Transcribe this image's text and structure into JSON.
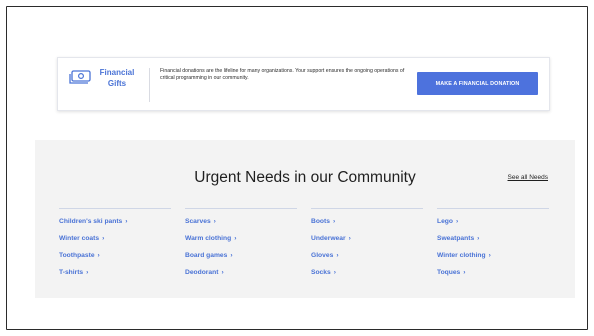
{
  "gifts": {
    "title": "Financial Gifts",
    "description": "Financial donations are the lifeline for many organizations. Your support ensures the ongoing operations of critical programming in our community.",
    "button_label": "MAKE A FINANCIAL DONATION",
    "icon": "money-bill-icon"
  },
  "needs": {
    "title": "Urgent Needs in our Community",
    "see_all_label": "See all Needs",
    "chevron": "›",
    "columns": [
      [
        "Children's ski pants",
        "Winter coats",
        "Toothpaste",
        "T-shirts"
      ],
      [
        "Scarves",
        "Warm clothing",
        "Board games",
        "Deodorant"
      ],
      [
        "Boots",
        "Underwear",
        "Gloves",
        "Socks"
      ],
      [
        "Lego",
        "Sweatpants",
        "Winter clothing",
        "Toques"
      ]
    ]
  },
  "colors": {
    "accent": "#4a73d6",
    "button": "#4d72dd",
    "section_bg": "#f3f3f3"
  }
}
